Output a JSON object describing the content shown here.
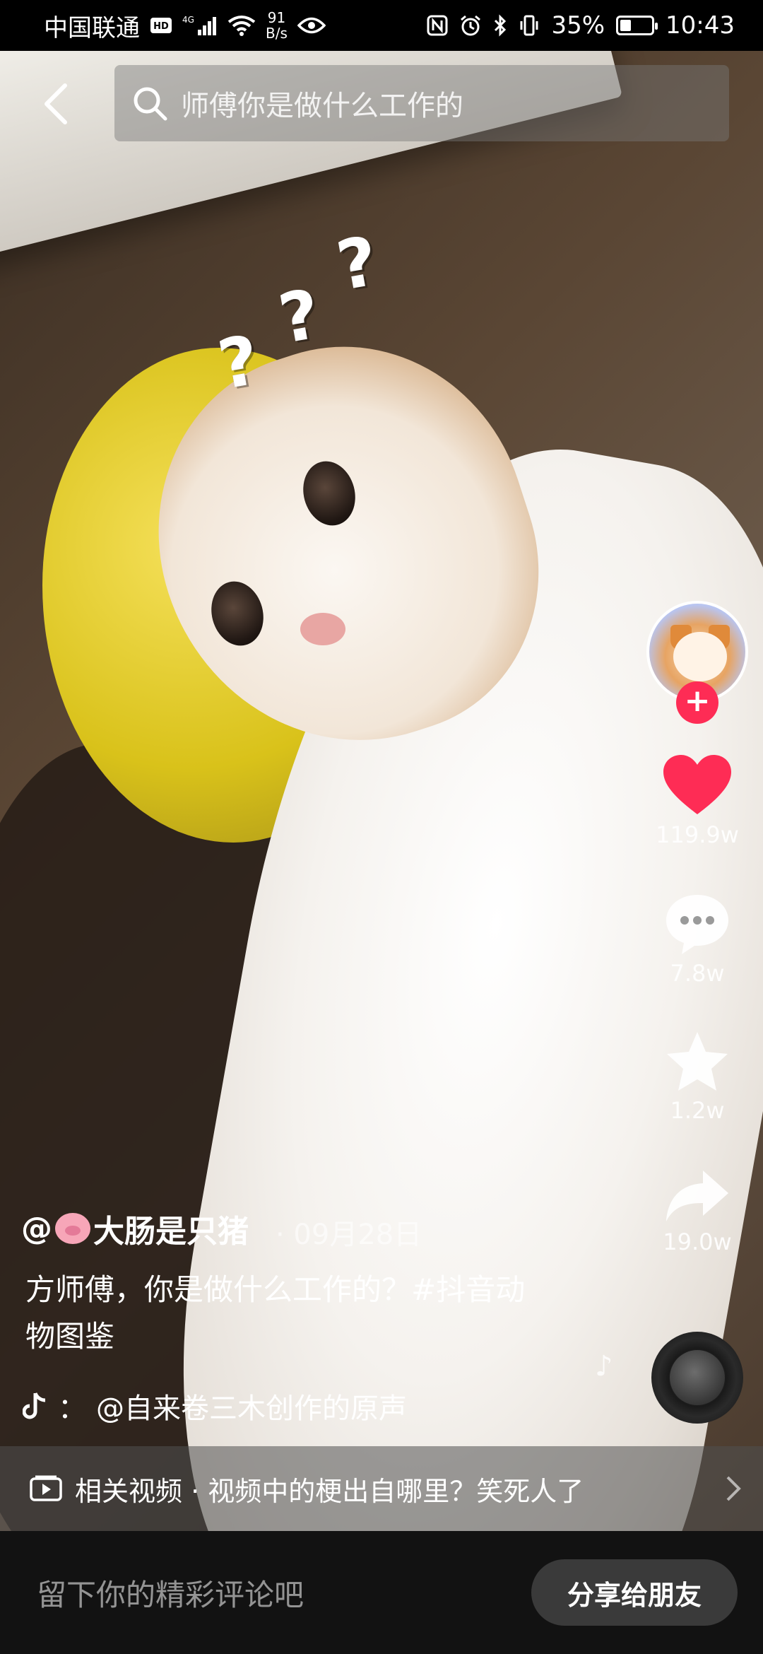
{
  "status_bar": {
    "carrier": "中国联通",
    "hd": "HD",
    "signal": "4G",
    "net_speed_value": "91",
    "net_speed_unit": "B/s",
    "battery_percent": "35%",
    "battery_level": 0.35,
    "time": "10:43",
    "icons": [
      "hd-icon",
      "signal-icon",
      "wifi-icon",
      "eye-icon",
      "nfc-icon",
      "alarm-icon",
      "bluetooth-icon",
      "vibrate-icon",
      "battery-icon"
    ]
  },
  "search": {
    "query": "师傅你是做什么工作的"
  },
  "actions": {
    "likes": "119.9w",
    "comments": "7.8w",
    "favorites": "1.2w",
    "shares": "19.0w",
    "follow_symbol": "+"
  },
  "post": {
    "author": "大肠是只猪",
    "author_prefix": "@",
    "date": "· 09月28日",
    "caption": "方师傅，你是做什么工作的？#抖音动物图鉴",
    "music_prefix": "：",
    "music": "@自来卷三木创作的原声"
  },
  "related": {
    "label": "相关视频 · 视频中的梗出自哪里？笑死人了"
  },
  "bottom": {
    "comment_placeholder": "留下你的精彩评论吧",
    "share_label": "分享给朋友"
  },
  "colors": {
    "like": "#fe2c55",
    "follow": "#fe2c55",
    "bottom_bar": "#121212",
    "share_button": "#3a3a3a"
  }
}
